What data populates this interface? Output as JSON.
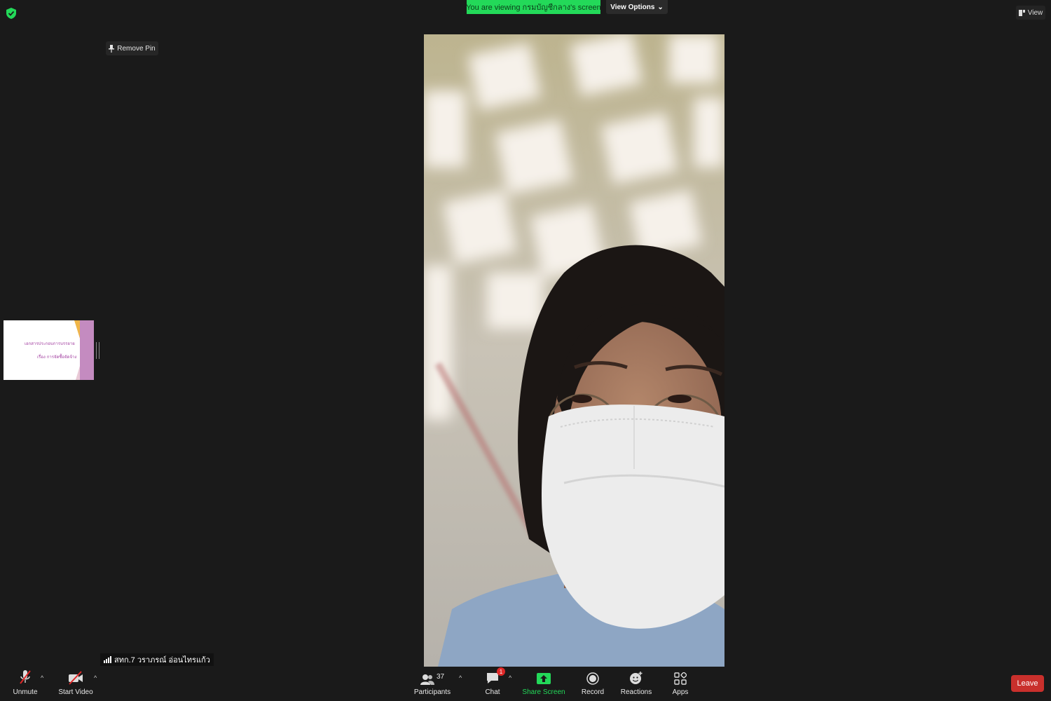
{
  "top_banner": {
    "viewing_text": "You are viewing กรมบัญชีกลาง's screen",
    "view_options_label": "View Options"
  },
  "view_button_label": "View",
  "remove_pin_label": "Remove Pin",
  "shared_thumbnail": {
    "line1": "เอกสารประกอบการบรรยาย",
    "line2": "เรื่อง การจัดซื้อจัดจ้าง"
  },
  "participant_name": "สทก.7 วราภรณ์ อ่อนไทรแก้ว",
  "toolbar": {
    "unmute_label": "Unmute",
    "start_video_label": "Start Video",
    "participants_label": "Participants",
    "participants_count": "37",
    "chat_label": "Chat",
    "chat_badge": "1",
    "share_screen_label": "Share Screen",
    "record_label": "Record",
    "reactions_label": "Reactions",
    "apps_label": "Apps",
    "leave_label": "Leave"
  },
  "colors": {
    "background": "#1a1a1a",
    "banner_green": "#23d959",
    "leave_red": "#c9302c",
    "share_green": "#23d959"
  }
}
